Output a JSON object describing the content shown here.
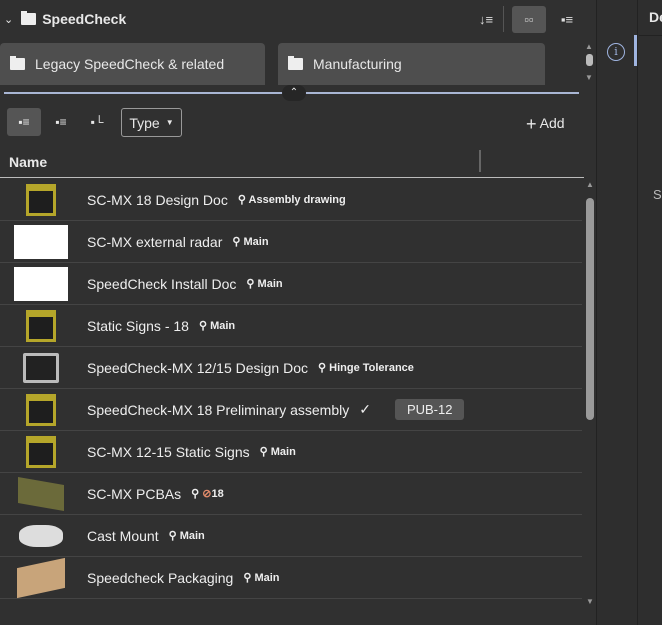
{
  "header": {
    "title": "SpeedCheck"
  },
  "folders": [
    {
      "label": "Legacy SpeedCheck & related"
    },
    {
      "label": "Manufacturing"
    }
  ],
  "toolbar": {
    "type_label": "Type",
    "add_label": "Add"
  },
  "table": {
    "name_header": "Name"
  },
  "rows": [
    {
      "name": "SC-MX 18 Design Doc",
      "branch": "Assembly drawing",
      "thumb": "sign"
    },
    {
      "name": "SC-MX external radar",
      "branch": "Main",
      "thumb": "white"
    },
    {
      "name": "SpeedCheck Install Doc",
      "branch": "Main",
      "thumb": "white"
    },
    {
      "name": "Static Signs - 18",
      "branch": "Main",
      "thumb": "sign"
    },
    {
      "name": "SpeedCheck-MX 12/15 Design Doc",
      "branch": "Hinge Tolerance",
      "thumb": "gray"
    },
    {
      "name": "SpeedCheck-MX 18 Preliminary assembly",
      "branch": "",
      "badge": "PUB-12",
      "thumb": "sign"
    },
    {
      "name": "SC-MX 12-15 Static Signs",
      "branch": "Main",
      "thumb": "sign"
    },
    {
      "name": "SC-MX PCBAs",
      "branch": "18",
      "thumb": "pcb"
    },
    {
      "name": "Cast Mount",
      "branch": "Main",
      "thumb": "mount"
    },
    {
      "name": "Speedcheck Packaging",
      "branch": "Main",
      "thumb": "box"
    }
  ],
  "right": {
    "header": "De",
    "text": "S"
  }
}
